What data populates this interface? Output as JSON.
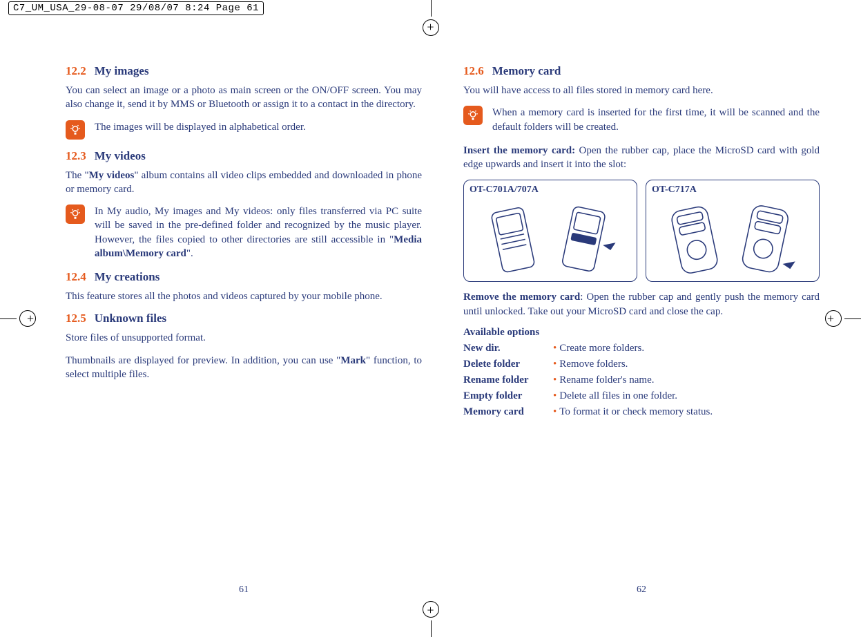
{
  "meta_tag": "C7_UM_USA_29-08-07  29/08/07  8:24  Page 61",
  "left": {
    "s122": {
      "num": "12.2",
      "title": "My images"
    },
    "body122": "You can select an image or a photo as main screen or the ON/OFF screen. You may also change it, send it by MMS or Bluetooth or assign it to a contact in the directory.",
    "note122": "The images will be displayed in alphabetical order.",
    "s123": {
      "num": "12.3",
      "title": "My videos"
    },
    "body123a": "The \"",
    "body123b": "My videos",
    "body123c": "\" album contains all video clips embedded and downloaded in phone or memory card.",
    "note123a": "In My audio, My images and My videos: only files transferred via PC suite will be saved in the pre-defined folder and recognized by the music player. However, the files copied to other directories are still accessible in \"",
    "note123b": "Media album\\Memory card",
    "note123c": "\".",
    "s124": {
      "num": "12.4",
      "title": "My creations"
    },
    "body124": "This feature stores all the photos and videos captured by your mobile phone.",
    "s125": {
      "num": "12.5",
      "title": "Unknown files"
    },
    "body125a": "Store files of unsupported format.",
    "body125b_a": "Thumbnails are displayed for preview. In addition, you can use \"",
    "body125b_b": "Mark",
    "body125b_c": "\" function, to select multiple files.",
    "page_num": "61"
  },
  "right": {
    "s126": {
      "num": "12.6",
      "title": "Memory card"
    },
    "body126": "You will have access to all files stored in memory card here.",
    "note126": "When a memory card is inserted for the first time, it will be scanned and the default folders will be created.",
    "insert_a": "Insert the memory card:",
    "insert_b": " Open the rubber cap, place the MicroSD card with gold edge upwards and insert it into the slot:",
    "dev1": "OT-C701A/707A",
    "dev2": "OT-C717A",
    "remove_a": "Remove the memory card",
    "remove_b": ": Open the rubber cap and gently push the memory card until unlocked. Take out your MicroSD card and close the cap.",
    "avail": "Available options",
    "opts": [
      {
        "name": "New dir.",
        "desc": "Create more folders."
      },
      {
        "name": "Delete folder",
        "desc": "Remove folders."
      },
      {
        "name": "Rename folder",
        "desc": "Rename folder's name."
      },
      {
        "name": "Empty folder",
        "desc": "Delete all files in one folder."
      },
      {
        "name": "Memory card",
        "desc": "To format it or check memory status."
      }
    ],
    "page_num": "62"
  }
}
